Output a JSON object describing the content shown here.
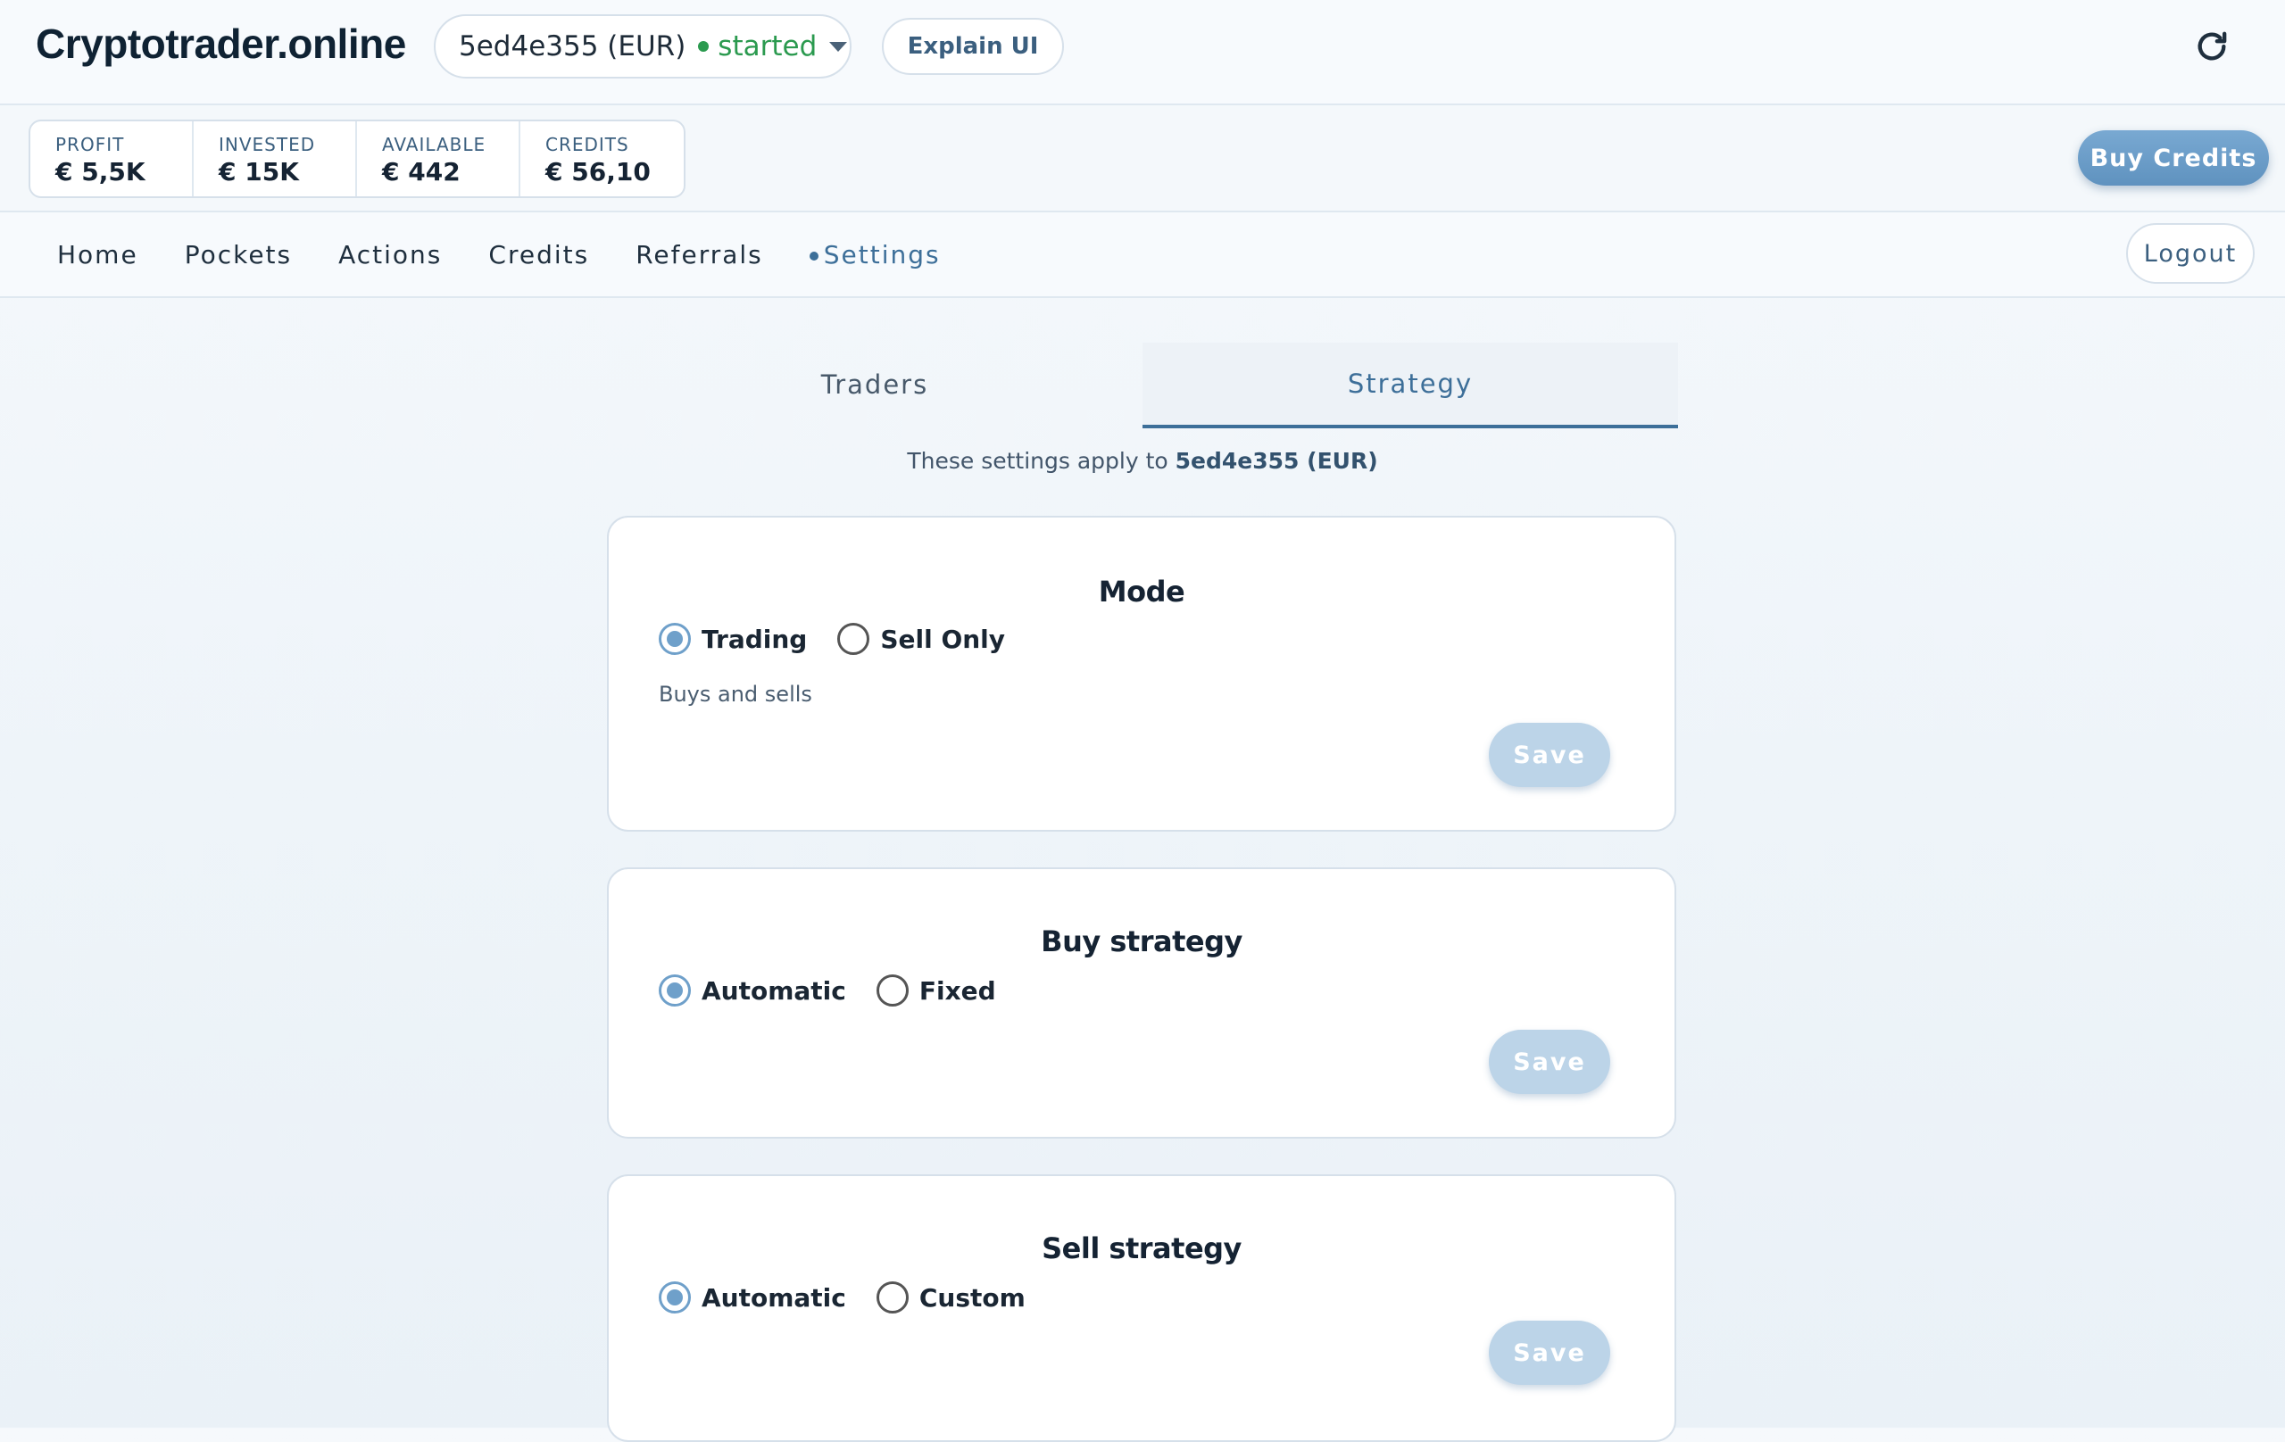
{
  "header": {
    "logo": "ryptotrader.online",
    "pocket": {
      "name": "5ed4e355 (EUR)",
      "status": "started",
      "status_color": "#2b9a4f"
    },
    "explain_label": "Explain UI",
    "refresh_icon": "refresh-icon"
  },
  "stats": [
    {
      "label": "PROFIT",
      "value": "€ 5,5K"
    },
    {
      "label": "INVESTED",
      "value": "€ 15K"
    },
    {
      "label": "AVAILABLE",
      "value": "€ 442"
    },
    {
      "label": "CREDITS",
      "value": "€ 56,10"
    }
  ],
  "buy_credits_label": "Buy Credits",
  "nav": {
    "items": [
      "Home",
      "Pockets",
      "Actions",
      "Credits",
      "Referrals",
      "Settings"
    ],
    "active": "Settings",
    "logout_label": "Logout"
  },
  "tabs": [
    {
      "label": "Traders",
      "active": false
    },
    {
      "label": "Strategy",
      "active": true
    }
  ],
  "note": {
    "prefix": "These settings apply to ",
    "pocket": "5ed4e355 (EUR)"
  },
  "cards": {
    "mode": {
      "title": "Mode",
      "options": [
        {
          "label": "Trading",
          "checked": true
        },
        {
          "label": "Sell Only",
          "checked": false
        }
      ],
      "description": "Buys and sells",
      "save_label": "Save"
    },
    "buy": {
      "title": "Buy strategy",
      "options": [
        {
          "label": "Automatic",
          "checked": true
        },
        {
          "label": "Fixed",
          "checked": false
        }
      ],
      "save_label": "Save"
    },
    "sell": {
      "title": "Sell strategy",
      "options": [
        {
          "label": "Automatic",
          "checked": true
        },
        {
          "label": "Custom",
          "checked": false
        }
      ],
      "save_label": "Save"
    }
  },
  "colors": {
    "accent": "#3d6f99",
    "button": "#6a9cc8",
    "save_disabled": "#bcd4e8"
  }
}
